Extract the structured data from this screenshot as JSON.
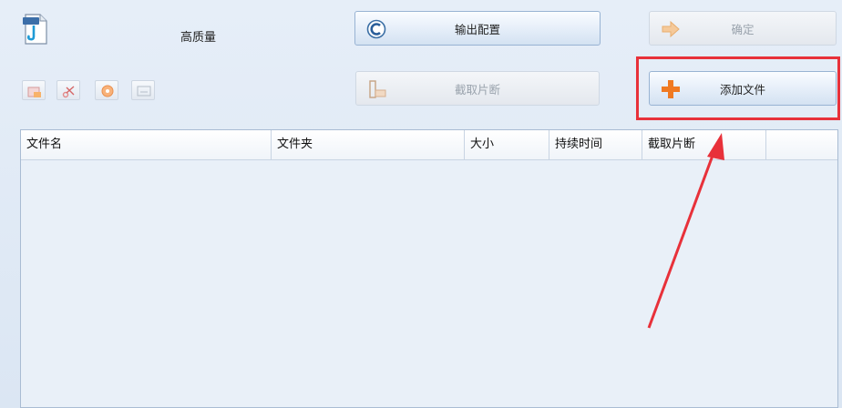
{
  "header": {
    "quality_label": "高质量"
  },
  "buttons": {
    "output_config": "输出配置",
    "confirm": "确定",
    "clip": "截取片断",
    "add_file": "添加文件"
  },
  "table": {
    "columns": [
      "文件名",
      "文件夹",
      "大小",
      "持续时间",
      "截取片断"
    ]
  },
  "colors": {
    "highlight": "#e8313a",
    "add_icon": "#f07a22"
  }
}
